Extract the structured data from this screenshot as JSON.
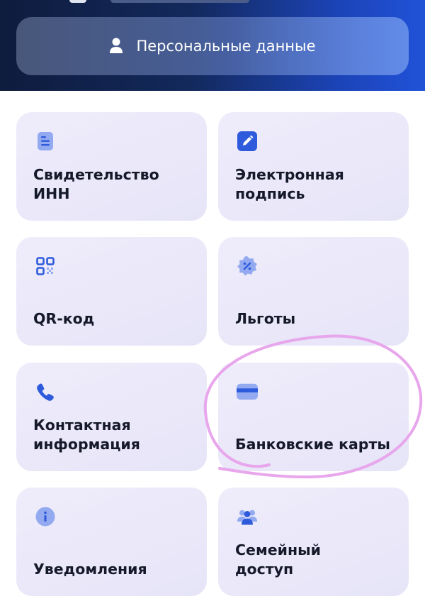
{
  "personal_button": {
    "label": "Персональные данные",
    "icon": "person-icon"
  },
  "cards": [
    {
      "label": "Свидетельство\nИНН",
      "icon": "document-icon"
    },
    {
      "label": "Электронная\nподпись",
      "icon": "pen-icon"
    },
    {
      "label": "QR-код",
      "icon": "qr-code-icon"
    },
    {
      "label": "Льготы",
      "icon": "discount-badge-icon"
    },
    {
      "label": "Контактная\nинформация",
      "icon": "phone-icon"
    },
    {
      "label": "Банковские карты",
      "icon": "bank-card-icon"
    },
    {
      "label": "Уведомления",
      "icon": "info-icon"
    },
    {
      "label": "Семейный\nдоступ",
      "icon": "family-icon"
    }
  ],
  "colors": {
    "accent": "#2e5bdc",
    "accent_light": "#93aaf0",
    "card_bg": "#ecebfa",
    "annotation": "#e8a6ec"
  }
}
